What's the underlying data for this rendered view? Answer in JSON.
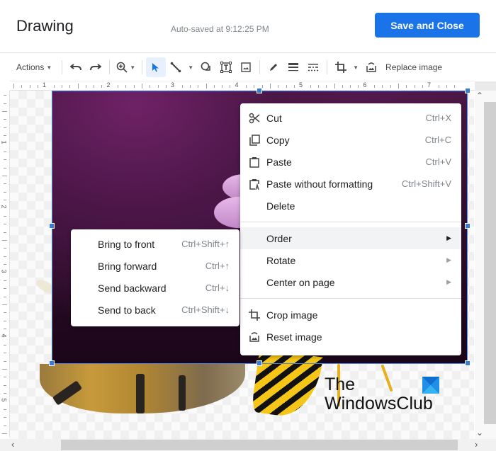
{
  "header": {
    "title": "Drawing",
    "autosave": "Auto-saved at 9:12:25 PM",
    "save_button": "Save and Close"
  },
  "toolbar": {
    "actions_label": "Actions",
    "replace_image_label": "Replace image",
    "icons": [
      "undo-icon",
      "redo-icon",
      "zoom-icon",
      "select-icon",
      "line-icon",
      "shape-icon",
      "textbox-icon",
      "image-icon",
      "pen-icon",
      "line-weight-icon",
      "line-dash-icon",
      "crop-icon",
      "replace-image-icon"
    ]
  },
  "ruler": {
    "horizontal_labels": [
      "1",
      "2",
      "3",
      "4",
      "5",
      "6",
      "7"
    ],
    "vertical_labels": [
      "1",
      "2",
      "3",
      "4",
      "5"
    ]
  },
  "context_menu": {
    "items": [
      {
        "label": "Cut",
        "shortcut": "Ctrl+X",
        "icon": "scissors-icon"
      },
      {
        "label": "Copy",
        "shortcut": "Ctrl+C",
        "icon": "copy-icon"
      },
      {
        "label": "Paste",
        "shortcut": "Ctrl+V",
        "icon": "paste-icon"
      },
      {
        "label": "Paste without formatting",
        "shortcut": "Ctrl+Shift+V",
        "icon": "paste-plain-icon"
      },
      {
        "label": "Delete",
        "shortcut": ""
      }
    ],
    "arrange_items": [
      {
        "label": "Order",
        "highlighted": true
      },
      {
        "label": "Rotate"
      },
      {
        "label": "Center on page"
      }
    ],
    "image_items": [
      {
        "label": "Crop image",
        "icon": "crop-icon"
      },
      {
        "label": "Reset image",
        "icon": "reset-image-icon"
      }
    ]
  },
  "order_submenu": {
    "items": [
      {
        "label": "Bring to front",
        "shortcut": "Ctrl+Shift+↑"
      },
      {
        "label": "Bring forward",
        "shortcut": "Ctrl+↑"
      },
      {
        "label": "Send backward",
        "shortcut": "Ctrl+↓"
      },
      {
        "label": "Send to back",
        "shortcut": "Ctrl+Shift+↓"
      }
    ]
  },
  "watermark": {
    "line1": "The",
    "line2": "WindowsClub"
  },
  "colors": {
    "accent": "#1a73e8",
    "selection": "#4a86e8"
  }
}
